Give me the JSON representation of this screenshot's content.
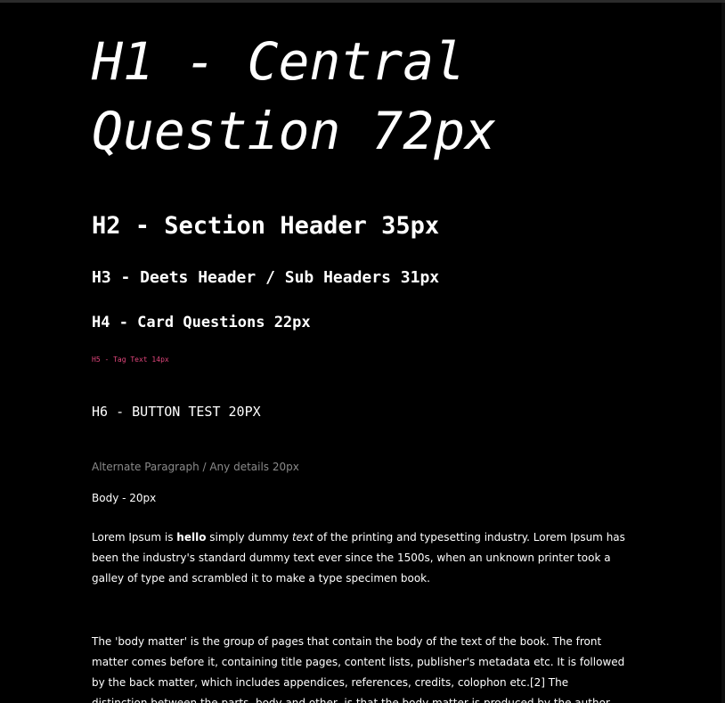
{
  "colors": {
    "background": "#000000",
    "text": "#ffffff",
    "tag": "#e0457b",
    "muted": "#8a8a8a"
  },
  "headings": {
    "h1": "H1 - Central Question 72px",
    "h2": "H2 - Section Header 35px",
    "h3": "H3 - Deets Header / Sub Headers 31px",
    "h4": "H4 - Card Questions 22px",
    "h5": "H5 - Tag Text 14px",
    "h6": "H6 - BUTTON TEST 20PX"
  },
  "alternate_paragraph": "Alternate Paragraph / Any details 20px",
  "body_label": "Body - 20px",
  "paragraph1": {
    "part1": "Lorem Ipsum is ",
    "bold": "hello",
    "part2": " simply dummy ",
    "italic": "text",
    "part3": " of the printing and typesetting industry. Lorem Ipsum has been the industry's standard dummy text ever since the 1500s, when an unknown printer took a galley of type and scrambled it to make a type specimen book."
  },
  "paragraph2": "The 'body matter' is the group of pages that contain the body of the text of the book. The front matter comes before it, containing title pages, content lists, publisher's metadata etc. It is followed by the back matter, which includes appendices, references, credits, colophon etc.[2] The distinction between the parts, body and other, is that the body matter is produced by the author, the front and back matter"
}
